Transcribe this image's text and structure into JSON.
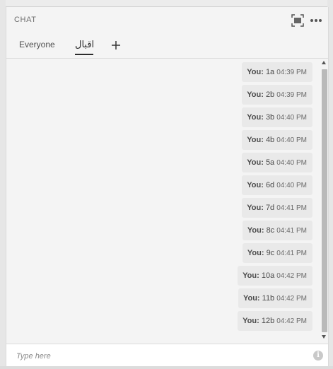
{
  "panel": {
    "title": "CHAT",
    "header_icons": [
      "maximize-icon",
      "more-options-icon"
    ]
  },
  "tabs": [
    {
      "label": "Everyone",
      "active": false
    },
    {
      "label": "اقبال",
      "active": true
    }
  ],
  "add_tab_icon": "plus-icon",
  "messages": [
    {
      "sender": "You:",
      "text": "1a",
      "time": "04:39 PM"
    },
    {
      "sender": "You:",
      "text": "2b",
      "time": "04:39 PM"
    },
    {
      "sender": "You:",
      "text": "3b",
      "time": "04:40 PM"
    },
    {
      "sender": "You:",
      "text": "4b",
      "time": "04:40 PM"
    },
    {
      "sender": "You:",
      "text": "5a",
      "time": "04:40 PM"
    },
    {
      "sender": "You:",
      "text": "6d",
      "time": "04:40 PM"
    },
    {
      "sender": "You:",
      "text": "7d",
      "time": "04:41 PM"
    },
    {
      "sender": "You:",
      "text": "8c",
      "time": "04:41 PM"
    },
    {
      "sender": "You:",
      "text": "9c",
      "time": "04:41 PM"
    },
    {
      "sender": "You:",
      "text": "10a",
      "time": "04:42 PM"
    },
    {
      "sender": "You:",
      "text": "11b",
      "time": "04:42 PM"
    },
    {
      "sender": "You:",
      "text": "12b",
      "time": "04:42 PM"
    }
  ],
  "composer": {
    "placeholder": "Type here",
    "value": "",
    "icon": "info-icon"
  },
  "colors": {
    "panel_bg": "#f4f4f4",
    "bubble_bg": "#e9e9e9",
    "text": "#4b4b4b",
    "accent": "#2c2c2c"
  }
}
